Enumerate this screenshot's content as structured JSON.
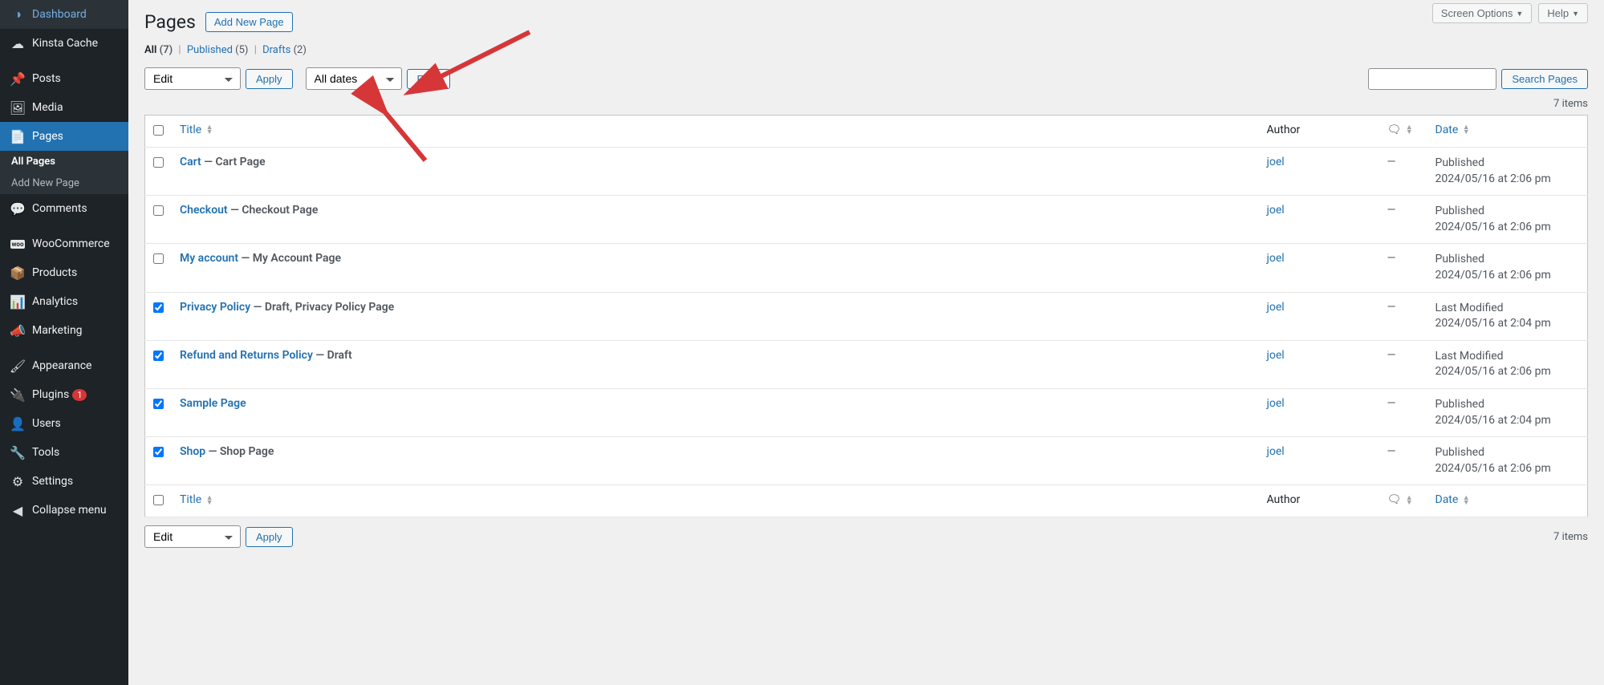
{
  "topbar": {
    "screen_options": "Screen Options",
    "help": "Help"
  },
  "sidebar": {
    "items": [
      {
        "label": "Dashboard",
        "icon": "◑"
      },
      {
        "label": "Kinsta Cache",
        "icon": "☁"
      },
      {
        "label": "Posts",
        "icon": "📌"
      },
      {
        "label": "Media",
        "icon": "🖼"
      },
      {
        "label": "Pages",
        "icon": "📄",
        "active": true
      },
      {
        "label": "Comments",
        "icon": "💬"
      },
      {
        "label": "WooCommerce",
        "icon": "woo"
      },
      {
        "label": "Products",
        "icon": "📦"
      },
      {
        "label": "Analytics",
        "icon": "📊"
      },
      {
        "label": "Marketing",
        "icon": "📣"
      },
      {
        "label": "Appearance",
        "icon": "🖌"
      },
      {
        "label": "Plugins",
        "icon": "🔌",
        "badge": "1"
      },
      {
        "label": "Users",
        "icon": "👤"
      },
      {
        "label": "Tools",
        "icon": "🔧"
      },
      {
        "label": "Settings",
        "icon": "⚙"
      },
      {
        "label": "Collapse menu",
        "icon": "◀"
      }
    ],
    "submenu": {
      "all_pages": "All Pages",
      "add_new": "Add New Page"
    }
  },
  "header": {
    "title": "Pages",
    "add_new": "Add New Page"
  },
  "views": {
    "all_label": "All",
    "all_count": "(7)",
    "published_label": "Published",
    "published_count": "(5)",
    "drafts_label": "Drafts",
    "drafts_count": "(2)"
  },
  "bulk": {
    "edit": "Edit",
    "apply": "Apply",
    "all_dates": "All dates",
    "filter": "Filter"
  },
  "search": {
    "button": "Search Pages"
  },
  "pagination": {
    "items": "7 items"
  },
  "columns": {
    "title": "Title",
    "author": "Author",
    "date": "Date"
  },
  "rows": [
    {
      "checked": false,
      "title": "Cart",
      "state": "— Cart Page",
      "author": "joel",
      "comments": "—",
      "status": "Published",
      "date": "2024/05/16 at 2:06 pm"
    },
    {
      "checked": false,
      "title": "Checkout",
      "state": "— Checkout Page",
      "author": "joel",
      "comments": "—",
      "status": "Published",
      "date": "2024/05/16 at 2:06 pm"
    },
    {
      "checked": false,
      "title": "My account",
      "state": "— My Account Page",
      "author": "joel",
      "comments": "—",
      "status": "Published",
      "date": "2024/05/16 at 2:06 pm"
    },
    {
      "checked": true,
      "title": "Privacy Policy",
      "state": "— Draft, Privacy Policy Page",
      "author": "joel",
      "comments": "—",
      "status": "Last Modified",
      "date": "2024/05/16 at 2:04 pm"
    },
    {
      "checked": true,
      "title": "Refund and Returns Policy",
      "state": "— Draft",
      "author": "joel",
      "comments": "—",
      "status": "Last Modified",
      "date": "2024/05/16 at 2:06 pm"
    },
    {
      "checked": true,
      "title": "Sample Page",
      "state": "",
      "author": "joel",
      "comments": "—",
      "status": "Published",
      "date": "2024/05/16 at 2:04 pm"
    },
    {
      "checked": true,
      "title": "Shop",
      "state": "— Shop Page",
      "author": "joel",
      "comments": "—",
      "status": "Published",
      "date": "2024/05/16 at 2:06 pm"
    }
  ]
}
